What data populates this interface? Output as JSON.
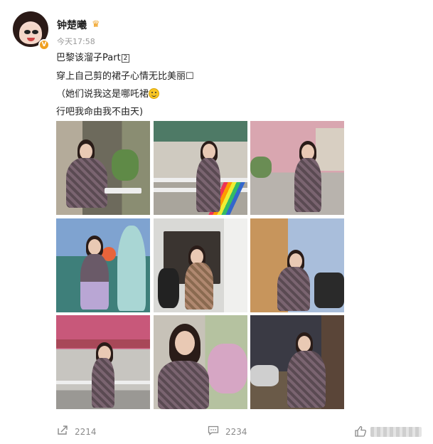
{
  "user": {
    "name": "钟楚曦",
    "badge_icon": "crown-icon",
    "verified_icon": "verified-v-icon",
    "time": "今天17:58"
  },
  "post": {
    "line1_text": "巴黎该溜子Part",
    "line1_num": "2",
    "line2": "穿上自己剪的裙子心情无比美丽☐",
    "line3": "（她们说我这是哪吒裙",
    "line4": "行吧我命由我不由天)"
  },
  "photos": [
    {
      "name": "photo-1",
      "bg": "#8a8577"
    },
    {
      "name": "photo-2",
      "bg": "#7c8c82"
    },
    {
      "name": "photo-3",
      "bg": "#b9a6a0"
    },
    {
      "name": "photo-4",
      "bg": "#6f8fb8"
    },
    {
      "name": "photo-5",
      "bg": "#c9cbc8"
    },
    {
      "name": "photo-6",
      "bg": "#b89a7e"
    },
    {
      "name": "photo-7",
      "bg": "#c46a7a"
    },
    {
      "name": "photo-8",
      "bg": "#b8b0a4"
    },
    {
      "name": "photo-9",
      "bg": "#3a3a40"
    }
  ],
  "actions": {
    "repost_icon": "share-icon",
    "repost_count": "2214",
    "comment_icon": "comment-icon",
    "comment_count": "2234",
    "like_icon": "like-icon"
  }
}
